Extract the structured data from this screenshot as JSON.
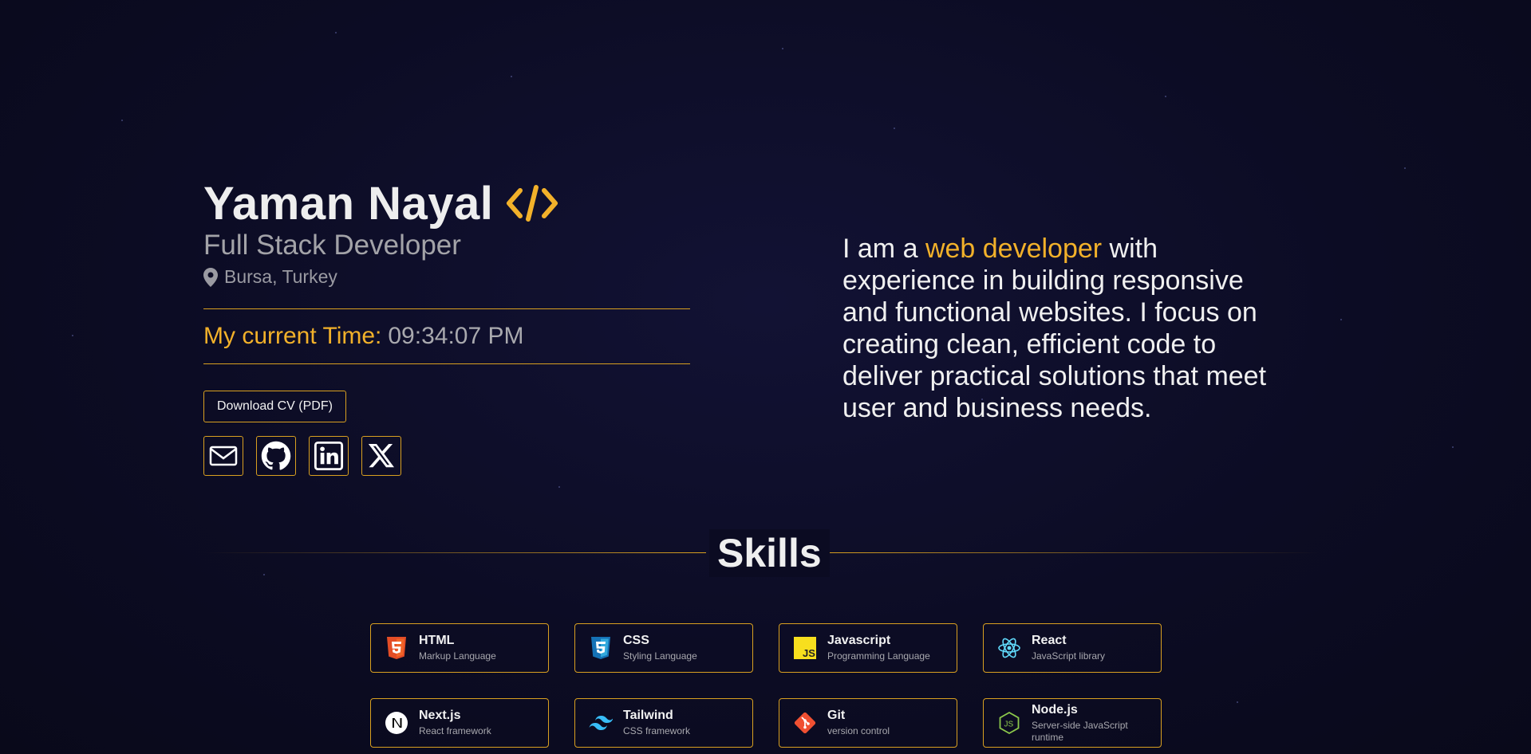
{
  "profile": {
    "name": "Yaman Nayal",
    "role": "Full Stack Developer",
    "location": "Bursa, Turkey",
    "time_label": "My current Time:",
    "time_value": "09:34:07 PM",
    "cv_button": "Download CV (PDF)"
  },
  "socials": [
    {
      "icon": "mail-icon"
    },
    {
      "icon": "github-icon"
    },
    {
      "icon": "linkedin-icon"
    },
    {
      "icon": "x-icon"
    }
  ],
  "bio": {
    "prefix": "I am a ",
    "highlight": "web developer",
    "suffix": " with experience in building responsive and functional websites. I focus on creating clean, efficient code to deliver practical solutions that meet user and business needs."
  },
  "skills": {
    "title": "Skills",
    "items": [
      {
        "name": "HTML",
        "desc": "Markup Language",
        "icon": "html5-icon"
      },
      {
        "name": "CSS",
        "desc": "Styling Language",
        "icon": "css3-icon"
      },
      {
        "name": "Javascript",
        "desc": "Programming Language",
        "icon": "javascript-icon"
      },
      {
        "name": "React",
        "desc": "JavaScript library",
        "icon": "react-icon"
      },
      {
        "name": "Next.js",
        "desc": "React framework",
        "icon": "nextjs-icon"
      },
      {
        "name": "Tailwind",
        "desc": "CSS framework",
        "icon": "tailwind-icon"
      },
      {
        "name": "Git",
        "desc": "version control",
        "icon": "git-icon"
      },
      {
        "name": "Node.js",
        "desc": "Server-side JavaScript runtime",
        "icon": "nodejs-icon"
      }
    ]
  },
  "colors": {
    "accent": "#f2b12a",
    "border": "#d9a020",
    "background": "#0c0c24",
    "text": "#ececec",
    "muted": "#a3a3a8"
  }
}
